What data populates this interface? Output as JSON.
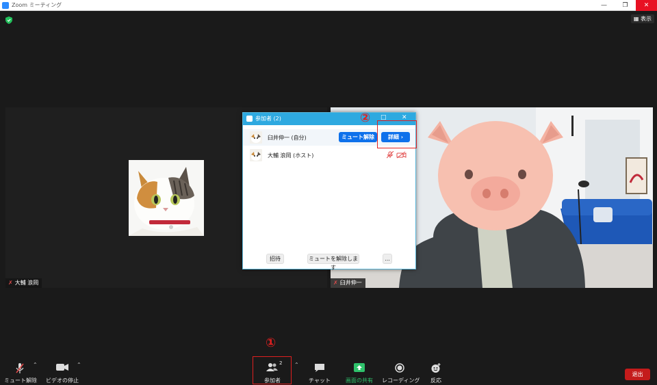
{
  "window": {
    "title": "Zoom ミーティング",
    "minimize_glyph": "—",
    "restore_glyph": "❐",
    "close_glyph": "✕"
  },
  "top_right": {
    "view_label": "表示",
    "view_icon": "grid-icon"
  },
  "tiles": {
    "left": {
      "name": "大輔 浪岡"
    },
    "right": {
      "name": "臼井伸一"
    }
  },
  "participants_panel": {
    "title": "参加者 (2)",
    "header_buttons": [
      "□",
      "✕"
    ],
    "participants": [
      {
        "name": "臼井伸一 (自分)",
        "unmute_label": "ミュート解除",
        "details_label": "詳細 ›"
      },
      {
        "name": "大輔 浪岡 (ホスト)",
        "status_icons": [
          "mic-muted-icon",
          "video-off-icon"
        ]
      }
    ],
    "footer": {
      "invite_label": "招待",
      "unmute_all_label": "ミュートを解除します",
      "more_label": "..."
    }
  },
  "annotations": {
    "callout_1": "①",
    "callout_2": "②"
  },
  "colors": {
    "accent_blue": "#0e71eb",
    "panel_header": "#2ea9e0",
    "leave_red": "#c41b1b",
    "share_green": "#2fc26b",
    "callout_red": "#e02020"
  },
  "toolbar": {
    "mute_label": "ミュート解除",
    "video_label": "ビデオの停止",
    "participants_label": "参加者",
    "participants_count": "2",
    "chat_label": "チャット",
    "share_label": "画面の共有",
    "record_label": "レコーディング",
    "reaction_label": "反応",
    "leave_label": "退出"
  }
}
